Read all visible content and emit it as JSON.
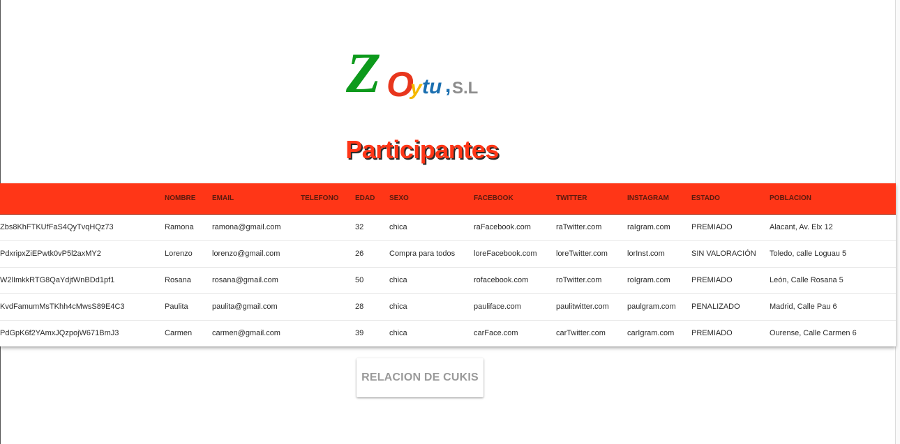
{
  "logo": {
    "text_z": "Z",
    "text_o": "O",
    "text_y": "y",
    "text_tu": "tu",
    "text_comma": ",",
    "text_sl": "S.L",
    "colors": {
      "z": "#0d9a1c",
      "o": "#e8361d",
      "y": "#f5b800",
      "tu": "#1b6fb0",
      "sl": "#8c8c8c"
    }
  },
  "page_title": "Participantes",
  "colors": {
    "accent": "#ff3617",
    "title_shadow": "#2a2a2a",
    "button_text": "#9a9a9a"
  },
  "table": {
    "headers": [
      "",
      "NOMBRE",
      "EMAIL",
      "TELEFONO",
      "EDAD",
      "SEXO",
      "FACEBOOK",
      "TWITTER",
      "INSTAGRAM",
      "ESTADO",
      "POBLACION"
    ],
    "rows": [
      [
        "Zbs8KhFTKUfFaS4QyTvqHQz73",
        "Ramona",
        "ramona@gmail.com",
        "",
        "32",
        "chica",
        "raFacebook.com",
        "raTwitter.com",
        "raIgram.com",
        "PREMIADO",
        "Alacant, Av. Elx 12"
      ],
      [
        "PdxripxZiEPwtk0vP5l2axMY2",
        "Lorenzo",
        "lorenzo@gmail.com",
        "",
        "26",
        "Compra para todos",
        "loreFacebook.com",
        "loreTwitter.com",
        "lorInst.com",
        "SIN VALORACIÓN",
        "Toledo, calle Loguau 5"
      ],
      [
        "W2lImkkRTG8QaYdjtWnBDd1pf1",
        "Rosana",
        "rosana@gmail.com",
        "",
        "50",
        "chica",
        "rofacebook.com",
        "roTwitter.com",
        "roIgram.com",
        "PREMIADO",
        "León, Calle Rosana 5"
      ],
      [
        "KvdFamumMsTKhh4cMwsS89E4C3",
        "Paulita",
        "paulita@gmail.com",
        "",
        "28",
        "chica",
        "pauliface.com",
        "paulitwitter.com",
        "paulgram.com",
        "PENALIZADO",
        "Madrid, Calle Pau 6"
      ],
      [
        "PdGpK6f2YAmxJQzpojW671BmJ3",
        "Carmen",
        "carmen@gmail.com",
        "",
        "39",
        "chica",
        "carFace.com",
        "carTwitter.com",
        "carIgram.com",
        "PREMIADO",
        "Ourense, Calle Carmen 6"
      ]
    ]
  },
  "button": {
    "label": "RELACION DE CUKIS"
  }
}
